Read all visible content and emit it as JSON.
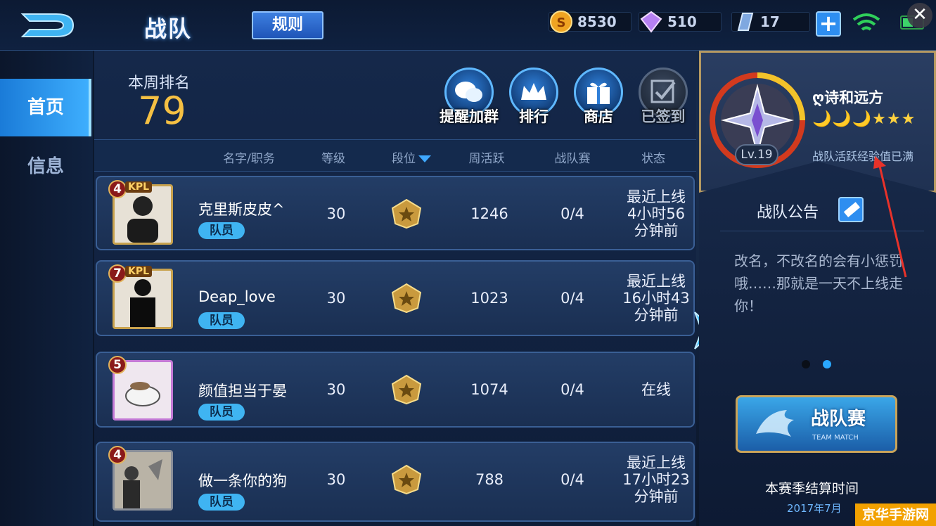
{
  "header": {
    "title": "战队",
    "rules_label": "规则",
    "currencies": [
      {
        "icon": "gold-coin-icon",
        "value": "8530"
      },
      {
        "icon": "diamond-icon",
        "value": "510"
      },
      {
        "icon": "ticket-icon",
        "value": "17"
      }
    ],
    "plus_label": "+",
    "close_label": "✕"
  },
  "nav": {
    "items": [
      {
        "label": "首页",
        "active": true
      },
      {
        "label": "信息",
        "active": false
      }
    ]
  },
  "summary": {
    "rank_label": "本周排名",
    "rank_value": "79"
  },
  "actions": [
    {
      "label": "提醒加群",
      "icon": "wechat-icon"
    },
    {
      "label": "排行",
      "icon": "crown-icon"
    },
    {
      "label": "商店",
      "icon": "gift-icon"
    },
    {
      "label": "已签到",
      "icon": "check-icon"
    }
  ],
  "table": {
    "columns": [
      "名字/职务",
      "等级",
      "段位",
      "周活跃",
      "战队赛",
      "状态"
    ],
    "rows": [
      {
        "badge": "4",
        "tag": "KPL",
        "name": "克里斯皮皮^",
        "role": "队员",
        "level": "30",
        "active": "1246",
        "match": "0/4",
        "status": [
          "最近上线",
          "4小时56",
          "分钟前"
        ]
      },
      {
        "badge": "7",
        "tag": "KPL",
        "name": "Deap_love",
        "role": "队员",
        "level": "30",
        "active": "1023",
        "match": "0/4",
        "status": [
          "最近上线",
          "16小时43",
          "分钟前"
        ]
      },
      {
        "badge": "5",
        "tag": "",
        "name": "颜值担当于晏",
        "role": "队员",
        "level": "30",
        "active": "1074",
        "match": "0/4",
        "status": [
          "在线"
        ]
      },
      {
        "badge": "4",
        "tag": "",
        "name": "做一条你的狗",
        "role": "队员",
        "level": "30",
        "active": "788",
        "match": "0/4",
        "status": [
          "最近上线",
          "17小时23",
          "分钟前"
        ]
      }
    ]
  },
  "team": {
    "level": "Lv.19",
    "name": "ღ诗和远方",
    "stars": "🌙🌙🌙★★★",
    "exp_text": "战队活跃经验值已满",
    "notice_title": "战队公告",
    "notice_body": "改名，不改名的会有小惩罚哦……那就是一天不上线走你！",
    "match_label": "战队赛",
    "match_sub": "TEAM MATCH",
    "season_label": "本赛季结算时间",
    "season_date": "2017年7月"
  },
  "watermark": "京华手游网",
  "colors": {
    "accent": "#3fa8ff",
    "gold": "#f5c043"
  }
}
